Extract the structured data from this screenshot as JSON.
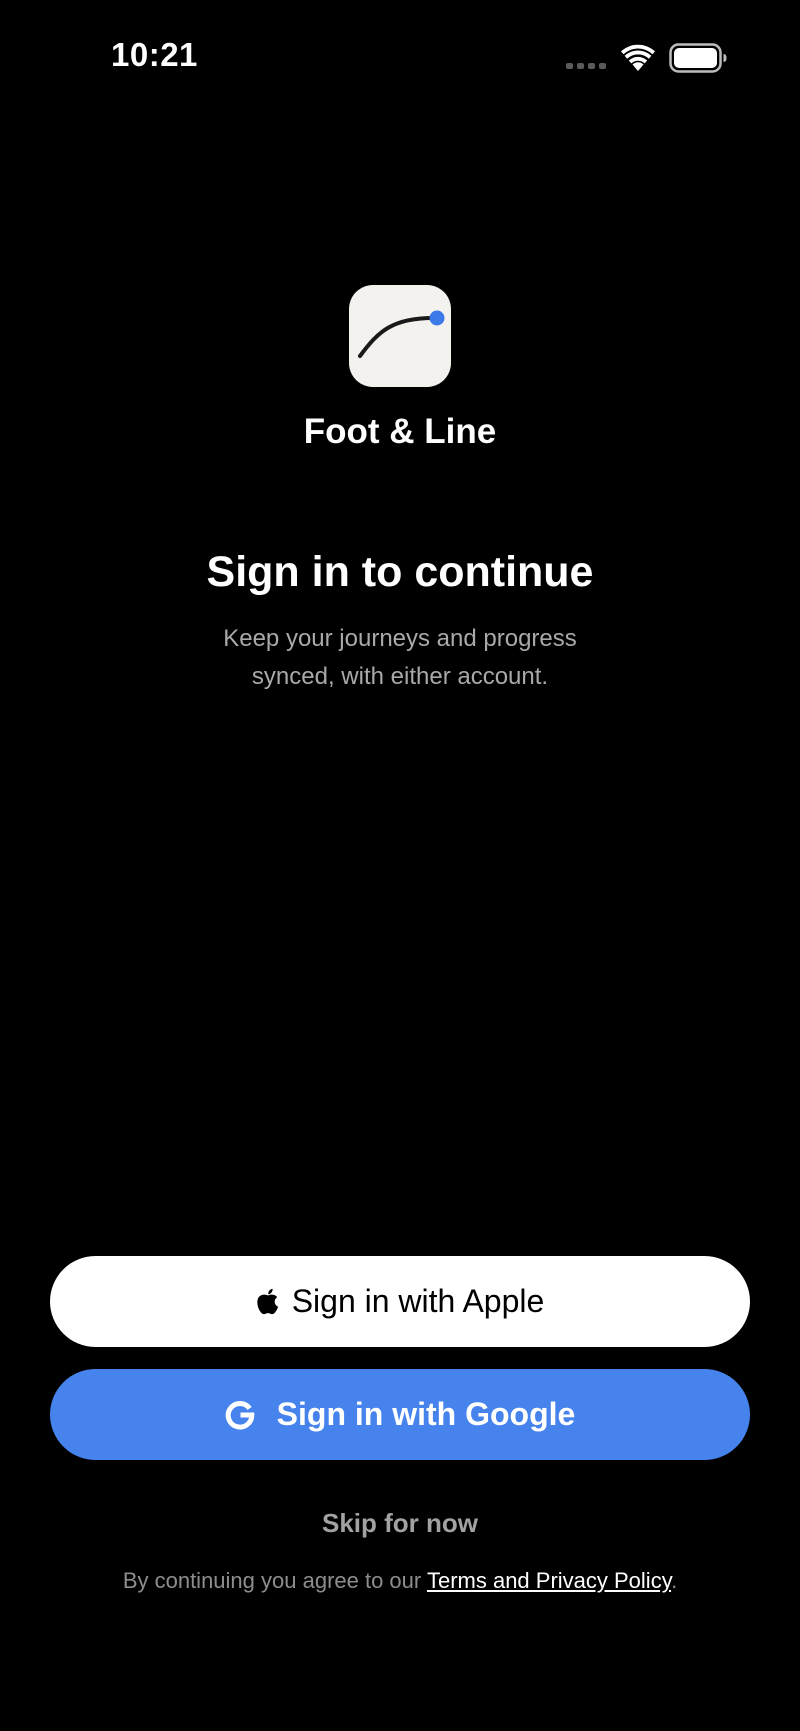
{
  "status_bar": {
    "time": "10:21",
    "icons": [
      "cellular-signal-icon",
      "wifi-icon",
      "battery-icon"
    ],
    "battery_level": 1.0
  },
  "app": {
    "name": "Foot & Line",
    "logo_icon": "curve-line-icon",
    "logo_colors": {
      "background": "#f3f2ee",
      "line": "#1a1a1a",
      "dot": "#3b7ae8"
    }
  },
  "main": {
    "headline": "Sign in to continue",
    "subtitle": "Keep your journeys and progress synced, with either account."
  },
  "actions": {
    "apple_label": "Sign in with Apple",
    "apple_icon": "apple-logo-icon",
    "google_label": "Sign in with Google",
    "google_icon": "google-g-icon",
    "skip_label": "Skip for now"
  },
  "legal": {
    "prefix": "By continuing you agree to our ",
    "link_text": "Terms and Privacy Policy",
    "suffix": "."
  },
  "colors": {
    "background": "#000000",
    "apple_button": "#ffffff",
    "google_button": "#4683ed",
    "secondary_text": "#a9a9a9"
  }
}
